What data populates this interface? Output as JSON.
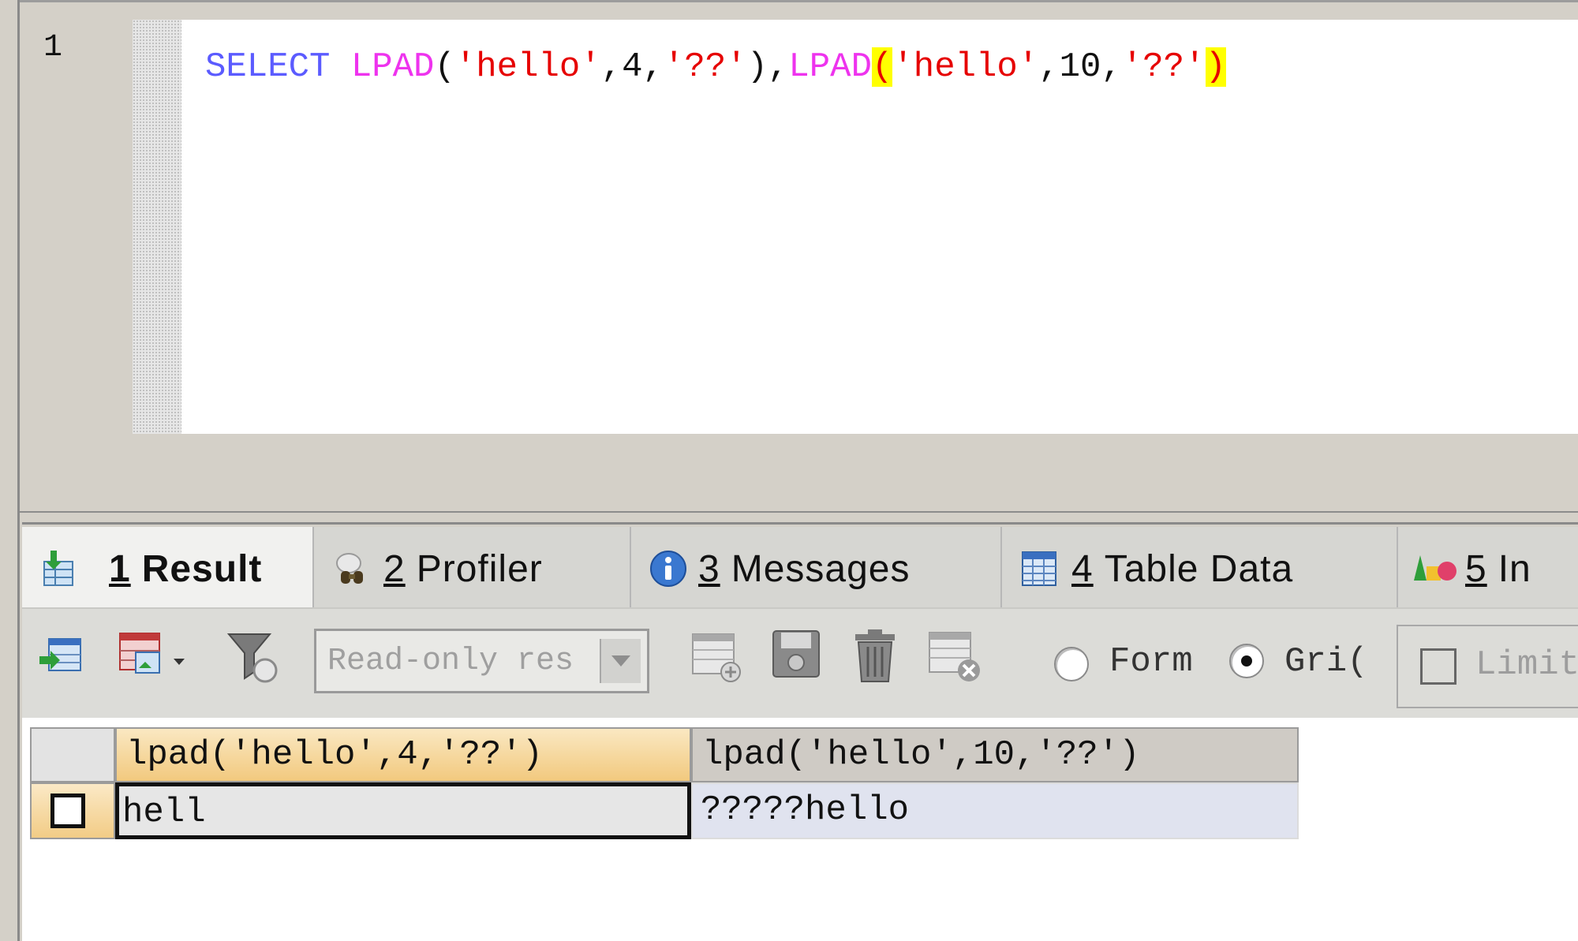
{
  "editor": {
    "line_number": "1",
    "code": {
      "select": "SELECT",
      "lpad1_fn": "LPAD",
      "lpad1_open": "(",
      "lpad1_str1": "'hello'",
      "lpad1_comma1": ",",
      "lpad1_num": "4",
      "lpad1_comma2": ",",
      "lpad1_str2": "'??'",
      "lpad1_close": ")",
      "sep": ",",
      "lpad2_fn": "LPAD",
      "lpad2_open": "(",
      "lpad2_str1": "'hello'",
      "lpad2_comma1": ",",
      "lpad2_num": "10",
      "lpad2_comma2": ",",
      "lpad2_str2": "'??'",
      "lpad2_close": ")"
    }
  },
  "tabs": [
    {
      "num": "1",
      "label": "Result",
      "icon": "result-icon"
    },
    {
      "num": "2",
      "label": "Profiler",
      "icon": "profiler-icon"
    },
    {
      "num": "3",
      "label": "Messages",
      "icon": "info-icon"
    },
    {
      "num": "4",
      "label": "Table Data",
      "icon": "table-icon"
    },
    {
      "num": "5",
      "label": "In",
      "icon": "shapes-icon"
    }
  ],
  "toolbar": {
    "readonly_select": "Read-only res",
    "form_label": "Form",
    "grid_label": "Gri(",
    "limit_label": "Limit",
    "form_selected": false,
    "grid_selected": true
  },
  "results": {
    "columns": [
      "lpad('hello',4,'??')",
      "lpad('hello',10,'??')"
    ],
    "rows": [
      [
        "hell",
        "?????hello"
      ]
    ]
  },
  "colors": {
    "keyword": "#5b5bff",
    "function": "#ee33ee",
    "string": "#e60000",
    "bracket_highlight": "#ffff00",
    "header_active": "#f5cf8c",
    "header_inactive": "#cfcbc5"
  }
}
